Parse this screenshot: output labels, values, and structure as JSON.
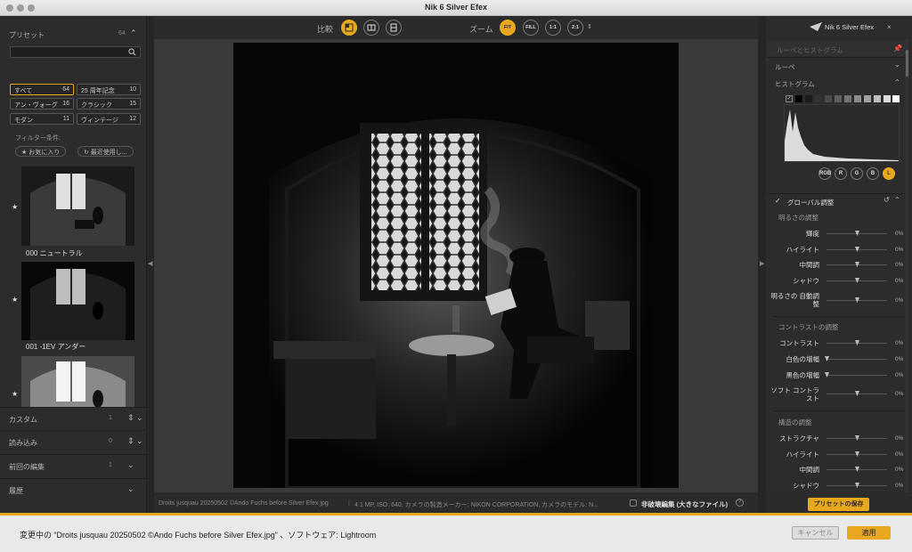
{
  "window": {
    "title": "Nik 6 Silver Efex"
  },
  "left_panel": {
    "presets_label": "プリセット",
    "presets_count": "64",
    "search_placeholder": "",
    "categories": [
      {
        "label": "すべて",
        "count": "64",
        "active": true
      },
      {
        "label": "25 周年記念",
        "count": "10"
      },
      {
        "label": "アン・ヴォーグ",
        "count": "16"
      },
      {
        "label": "クラシック",
        "count": "15"
      },
      {
        "label": "モダン",
        "count": "11"
      },
      {
        "label": "ヴィンテージ",
        "count": "12"
      }
    ],
    "filter_label": "フィルター条件:",
    "filter_chips": [
      "★ お気に入り",
      "↻ 最近使用し..."
    ],
    "presets": [
      {
        "label": "000 ニュートラル",
        "star": "★"
      },
      {
        "label": "001 -1EV アンダー",
        "star": "★"
      },
      {
        "label": "",
        "star": "★"
      }
    ],
    "sections": [
      {
        "label": "カスタム",
        "count": "1"
      },
      {
        "label": "読み込み",
        "count": "0"
      },
      {
        "label": "前回の編集",
        "count": "1"
      },
      {
        "label": "履歴",
        "count": ""
      }
    ]
  },
  "toolbar": {
    "compare_label": "比較",
    "zoom_label": "ズーム",
    "zoom_buttons": [
      "FIT",
      "FILL",
      "1:1",
      "2:1"
    ],
    "zoom_active": "FIT"
  },
  "status": {
    "filename": "Droits jusquau 20250502 ©Ando Fuchs before Silver Efex.jpg",
    "meta": "4.1 MP, ISO: 640, カメラの製造メーカー: NIKON CORPORATION, カメラのモデル: N...",
    "non_destructive_label": "非破壊編集 (大きなファイル)",
    "help": "?"
  },
  "right_panel": {
    "brand": "Nik 6 Silver Efex",
    "loupe_histogram": "ルーペとヒストグラム",
    "loupe": "ルーペ",
    "histogram": "ヒストグラム",
    "channels": [
      "RGB",
      "R",
      "G",
      "B",
      "L"
    ],
    "channel_active": "L",
    "global_adjust": "グローバル調整",
    "brightness_group": "明るさの調整",
    "brightness_sliders": [
      {
        "label": "輝度",
        "value": "0%",
        "level": 0.5
      },
      {
        "label": "ハイライト",
        "value": "0%",
        "level": 0.5
      },
      {
        "label": "中間調",
        "value": "0%",
        "level": 0.5
      },
      {
        "label": "シャドウ",
        "value": "0%",
        "level": 0.5
      },
      {
        "label": "明るさの 自動調整",
        "value": "0%",
        "level": 0.5
      }
    ],
    "contrast_group": "コントラストの調整",
    "contrast_sliders": [
      {
        "label": "コントラスト",
        "value": "0%",
        "level": 0.5
      },
      {
        "label": "白色の増幅",
        "value": "0%",
        "level": 0.0
      },
      {
        "label": "黒色の増幅",
        "value": "0%",
        "level": 0.0
      },
      {
        "label": "ソフト コントラスト",
        "value": "0%",
        "level": 0.5
      }
    ],
    "structure_group": "構造の調整",
    "structure_sliders": [
      {
        "label": "ストラクチャ",
        "value": "0%",
        "level": 0.5
      },
      {
        "label": "ハイライト",
        "value": "0%",
        "level": 0.5
      },
      {
        "label": "中間調",
        "value": "0%",
        "level": 0.5
      },
      {
        "label": "シャドウ",
        "value": "0%",
        "level": 0.5
      }
    ],
    "save_preset": "プリセットの保存"
  },
  "bottom": {
    "message": "変更中の “Droits jusquau 20250502 ©Ando Fuchs before Silver Efex.jpg” 、ソフトウェア: Lightroom",
    "cancel": "キャンセル",
    "apply": "適用"
  },
  "colors": {
    "accent": "#e7a820",
    "panel": "#2c2c2c",
    "canvas": "#3a3a3a"
  }
}
